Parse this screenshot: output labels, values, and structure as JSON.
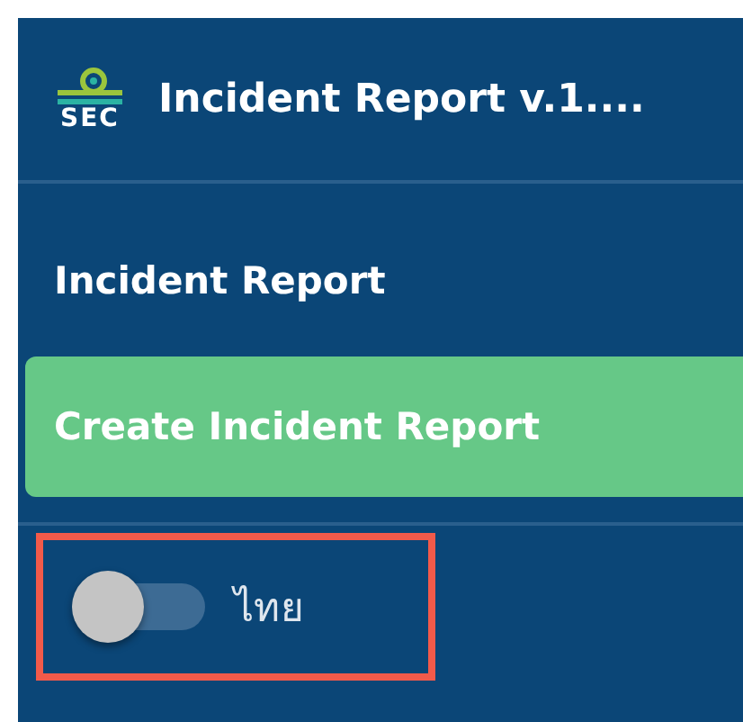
{
  "header": {
    "logo_text": "SEC",
    "title": "Incident Report v.1...."
  },
  "menu": [
    {
      "label": "Incident Report",
      "selected": false
    },
    {
      "label": "Create Incident Report",
      "selected": true
    }
  ],
  "language_toggle": {
    "label": "ไทย",
    "on": false,
    "highlighted": true
  }
}
